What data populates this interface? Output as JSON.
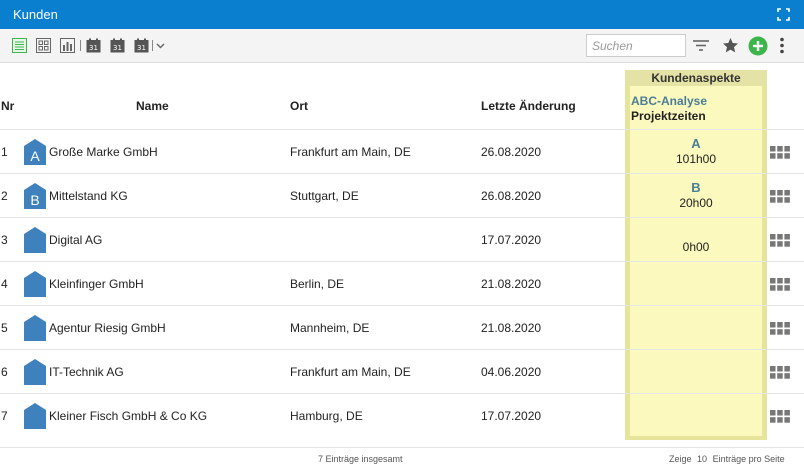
{
  "window": {
    "title": "Kunden"
  },
  "toolbar": {
    "search_placeholder": "Suchen"
  },
  "table": {
    "headers": {
      "nr": "Nr",
      "name": "Name",
      "ort": "Ort",
      "date": "Letzte Änderung"
    },
    "aspects": {
      "title": "Kundenaspekte",
      "sub1": "ABC-Analyse",
      "sub2": "Projektzeiten"
    },
    "rows": [
      {
        "nr": "1",
        "badge": "A",
        "name": "Große Marke GmbH",
        "ort": "Frankfurt am Main, DE",
        "date": "26.08.2020",
        "abc": "A",
        "time": "101h00"
      },
      {
        "nr": "2",
        "badge": "B",
        "name": "Mittelstand KG",
        "ort": "Stuttgart, DE",
        "date": "26.08.2020",
        "abc": "B",
        "time": "20h00"
      },
      {
        "nr": "3",
        "badge": "",
        "name": "Digital AG",
        "ort": "",
        "date": "17.07.2020",
        "abc": "",
        "time": "0h00"
      },
      {
        "nr": "4",
        "badge": "",
        "name": "Kleinfinger GmbH",
        "ort": "Berlin, DE",
        "date": "21.08.2020",
        "abc": "",
        "time": ""
      },
      {
        "nr": "5",
        "badge": "",
        "name": "Agentur Riesig GmbH",
        "ort": "Mannheim, DE",
        "date": "21.08.2020",
        "abc": "",
        "time": ""
      },
      {
        "nr": "6",
        "badge": "",
        "name": "IT-Technik AG",
        "ort": "Frankfurt am Main, DE",
        "date": "04.06.2020",
        "abc": "",
        "time": ""
      },
      {
        "nr": "7",
        "badge": "",
        "name": "Kleiner Fisch GmbH & Co KG",
        "ort": "Hamburg, DE",
        "date": "17.07.2020",
        "abc": "",
        "time": ""
      }
    ]
  },
  "footer": {
    "total": "7 Einträge insgesamt",
    "show": "Zeige",
    "per_page": "10",
    "per_page_suffix": "Einträge pro Seite"
  },
  "colors": {
    "accent": "#0a7fd0",
    "badge": "#3f81bd",
    "highlight": "#fbf9bd",
    "highlight_border": "#e6e39a",
    "green": "#3cb54a"
  },
  "icons": [
    "fullscreen-icon",
    "list-view-icon",
    "tile-view-icon",
    "chart-view-icon",
    "calendar-icon",
    "filter-icon",
    "star-icon",
    "add-icon",
    "more-icon",
    "row-menu-icon",
    "company-badge-icon"
  ]
}
